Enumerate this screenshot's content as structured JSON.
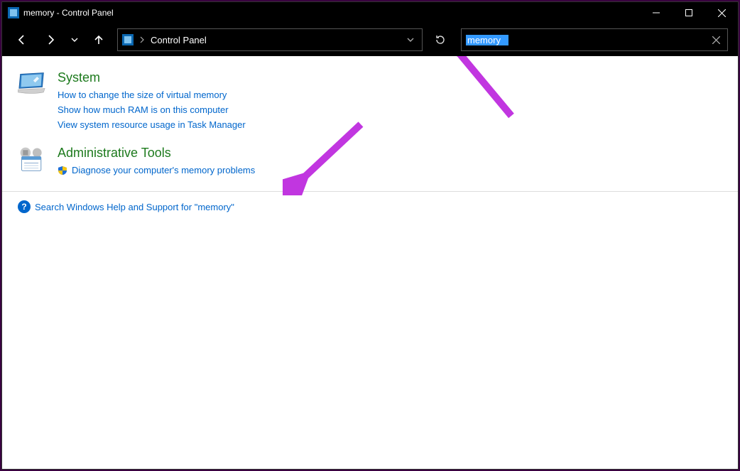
{
  "titlebar": {
    "title": "memory - Control Panel"
  },
  "address": {
    "location": "Control Panel"
  },
  "search": {
    "value": "memory"
  },
  "results": {
    "system": {
      "title": "System",
      "links": [
        "How to change the size of virtual memory",
        "Show how much RAM is on this computer",
        "View system resource usage in Task Manager"
      ]
    },
    "admin": {
      "title": "Administrative Tools",
      "link": "Diagnose your computer's memory problems"
    }
  },
  "help": {
    "text": "Search Windows Help and Support for \"memory\""
  }
}
